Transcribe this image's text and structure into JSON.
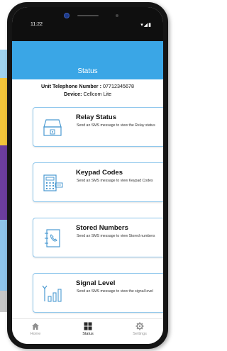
{
  "status_bar": {
    "time": "11:22",
    "icons": "▾◢▮"
  },
  "header": {
    "title": "Status"
  },
  "info": {
    "phone_label": "Unit Telephone Number :",
    "phone_value": "07712345678",
    "device_label": "Device:",
    "device_value": "Cellcom Lite"
  },
  "cards": [
    {
      "title": "Relay Status",
      "desc": "Send an SMS message to view the Relay status",
      "icon": "relay-icon"
    },
    {
      "title": "Keypad Codes",
      "desc": "Send an SMS message to view Keypad Codes",
      "icon": "keypad-icon"
    },
    {
      "title": "Stored Numbers",
      "desc": "Send an SMS message to view Stored numbers",
      "icon": "phonebook-icon"
    },
    {
      "title": "Signal Level",
      "desc": "Send an SMS message to view the signal level",
      "icon": "signal-icon"
    }
  ],
  "nav": [
    {
      "label": "Home",
      "icon": "home-icon"
    },
    {
      "label": "Status",
      "icon": "grid-icon"
    },
    {
      "label": "Settings",
      "icon": "gear-icon"
    }
  ],
  "colors": {
    "accent": "#3aa6e6",
    "card_border": "#8fc7ec",
    "icon_stroke": "#4b9ad1"
  }
}
